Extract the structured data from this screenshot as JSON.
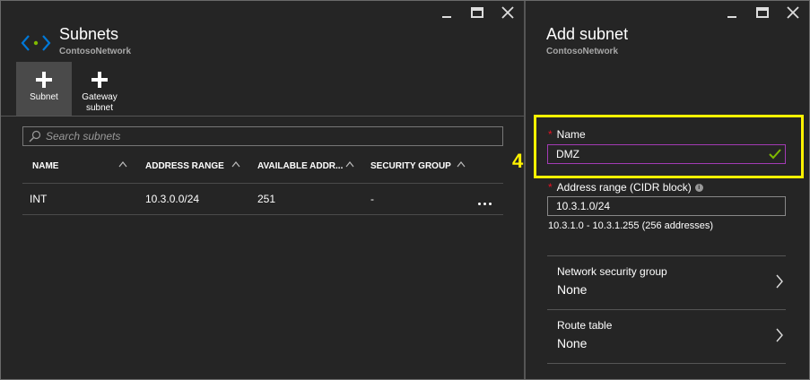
{
  "left_blade": {
    "title": "Subnets",
    "subtitle": "ContosoNetwork",
    "icon": "subnet-brackets-icon",
    "commands": [
      {
        "label": "Subnet",
        "icon": "plus-icon",
        "active": true
      },
      {
        "label": "Gateway subnet",
        "icon": "plus-icon",
        "active": false
      }
    ],
    "search": {
      "placeholder": "Search subnets",
      "value": ""
    },
    "table": {
      "columns": [
        "NAME",
        "ADDRESS RANGE",
        "AVAILABLE ADDR...",
        "SECURITY GROUP"
      ],
      "rows": [
        {
          "name": "INT",
          "address_range": "10.3.0.0/24",
          "available": "251",
          "security_group": "-"
        }
      ]
    }
  },
  "right_blade": {
    "title": "Add subnet",
    "subtitle": "ContosoNetwork",
    "step_marker": "4",
    "name_field": {
      "label": "Name",
      "required_mark": "*",
      "value": "DMZ",
      "valid": true
    },
    "address_field": {
      "label": "Address range (CIDR block)",
      "required_mark": "*",
      "value": "10.3.1.0/24",
      "hint": "10.3.1.0 - 10.3.1.255 (256 addresses)",
      "info_icon": "i"
    },
    "pickers": [
      {
        "label": "Network security group",
        "value": "None"
      },
      {
        "label": "Route table",
        "value": "None"
      }
    ]
  },
  "colors": {
    "background": "#252525",
    "highlight": "#fff200",
    "valid_check": "#7fba00",
    "active_input_border": "#a33bb4",
    "required": "#e81123",
    "brand_icon": "#0078d7"
  }
}
